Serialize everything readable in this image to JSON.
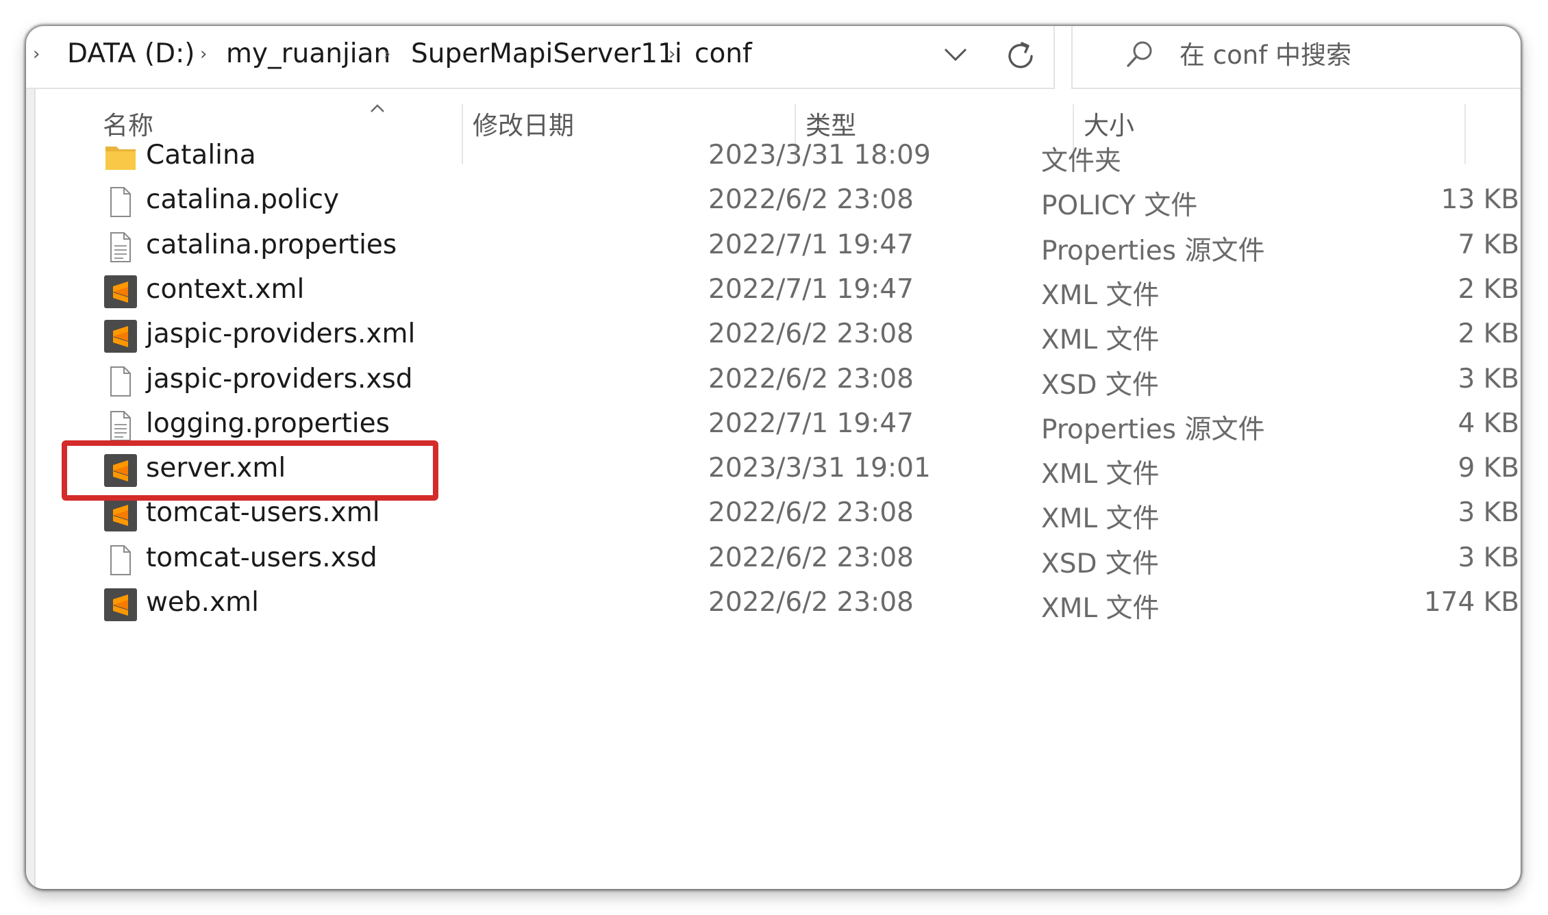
{
  "breadcrumb": [
    "DATA (D:)",
    "my_ruanjian",
    "SuperMapiServer11i",
    "conf"
  ],
  "search": {
    "placeholder": "在 conf 中搜索"
  },
  "columns": {
    "name": "名称",
    "date": "修改日期",
    "type": "类型",
    "size": "大小"
  },
  "files": [
    {
      "name": "Catalina",
      "date": "2023/3/31 18:09",
      "type": "文件夹",
      "size": "",
      "icon": "folder-icon"
    },
    {
      "name": "catalina.policy",
      "date": "2022/6/2 23:08",
      "type": "POLICY 文件",
      "size": "13 KB",
      "icon": "file-icon"
    },
    {
      "name": "catalina.properties",
      "date": "2022/7/1 19:47",
      "type": "Properties 源文件",
      "size": "7 KB",
      "icon": "text-file-icon"
    },
    {
      "name": "context.xml",
      "date": "2022/7/1 19:47",
      "type": "XML 文件",
      "size": "2 KB",
      "icon": "sublime-xml-icon"
    },
    {
      "name": "jaspic-providers.xml",
      "date": "2022/6/2 23:08",
      "type": "XML 文件",
      "size": "2 KB",
      "icon": "sublime-xml-icon"
    },
    {
      "name": "jaspic-providers.xsd",
      "date": "2022/6/2 23:08",
      "type": "XSD 文件",
      "size": "3 KB",
      "icon": "file-icon"
    },
    {
      "name": "logging.properties",
      "date": "2022/7/1 19:47",
      "type": "Properties 源文件",
      "size": "4 KB",
      "icon": "text-file-icon"
    },
    {
      "name": "server.xml",
      "date": "2023/3/31 19:01",
      "type": "XML 文件",
      "size": "9 KB",
      "icon": "sublime-xml-icon"
    },
    {
      "name": "tomcat-users.xml",
      "date": "2022/6/2 23:08",
      "type": "XML 文件",
      "size": "3 KB",
      "icon": "sublime-xml-icon"
    },
    {
      "name": "tomcat-users.xsd",
      "date": "2022/6/2 23:08",
      "type": "XSD 文件",
      "size": "3 KB",
      "icon": "file-icon"
    },
    {
      "name": "web.xml",
      "date": "2022/6/2 23:08",
      "type": "XML 文件",
      "size": "174 KB",
      "icon": "sublime-xml-icon"
    }
  ],
  "highlight": {
    "file": "server.xml",
    "color": "#d32a2a"
  },
  "colors": {
    "folder": "#f8c846",
    "sublime": "#ff9800",
    "sublime_bg": "#4a4a4a"
  }
}
